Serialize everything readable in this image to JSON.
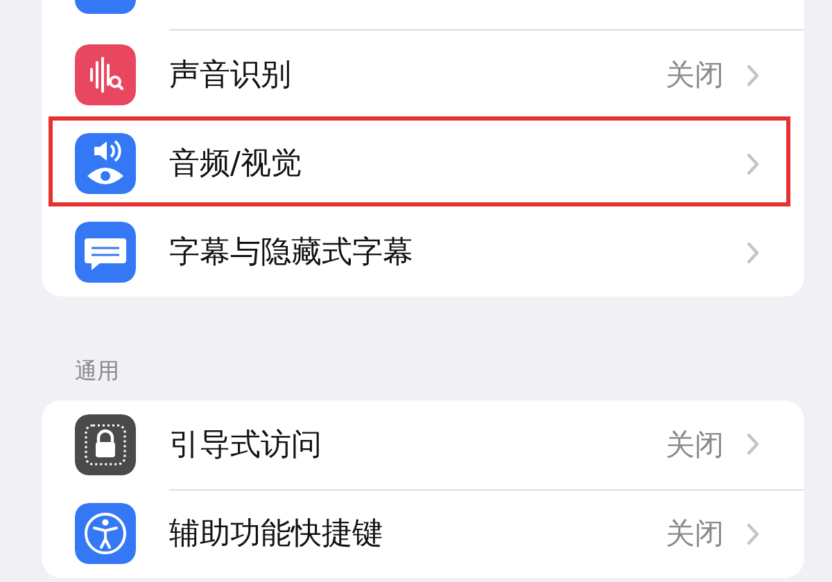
{
  "sections": [
    {
      "rows": [
        {
          "kind": "partial",
          "color": "#3478f6"
        },
        {
          "kind": "item",
          "label": "声音识别",
          "value": "关闭",
          "color": "#e8475f",
          "highlighted": false
        },
        {
          "kind": "item",
          "label": "音频/视觉",
          "color": "#3478f6",
          "highlighted": true
        },
        {
          "kind": "item",
          "label": "字幕与隐藏式字幕",
          "color": "#3478f6",
          "highlighted": false
        }
      ]
    },
    {
      "header": "通用",
      "rows": [
        {
          "kind": "item",
          "label": "引导式访问",
          "value": "关闭",
          "color": "#4a4a4c",
          "highlighted": false
        },
        {
          "kind": "item",
          "label": "辅助功能快捷键",
          "value": "关闭",
          "color": "#3478f6",
          "highlighted": false
        }
      ]
    }
  ]
}
